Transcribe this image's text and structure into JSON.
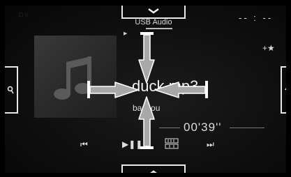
{
  "header": {
    "source_label": "USB Audio",
    "clock": "-- : --"
  },
  "track": {
    "title": "duck.mp3",
    "artist": "banzou",
    "elapsed": "00'39''"
  },
  "icons": {
    "collapse": "chevron-down-icon",
    "expand": "chevron-up-icon",
    "search": "search-icon",
    "sort": "sort-icon",
    "album_placeholder": "music-note-icon",
    "favorite": "add-favorite-icon",
    "prev": "previous-track-icon",
    "play_pause": "play-pause-icon",
    "repeat_mode": "repeat-mode-icon",
    "next": "next-track-icon",
    "status": "status-icon"
  },
  "colors": {
    "background": "#000000",
    "screen": "#141414",
    "text": "#eeeeee",
    "arrow_fill": "#a8a8a8",
    "arrow_stroke": "#ffffff"
  }
}
